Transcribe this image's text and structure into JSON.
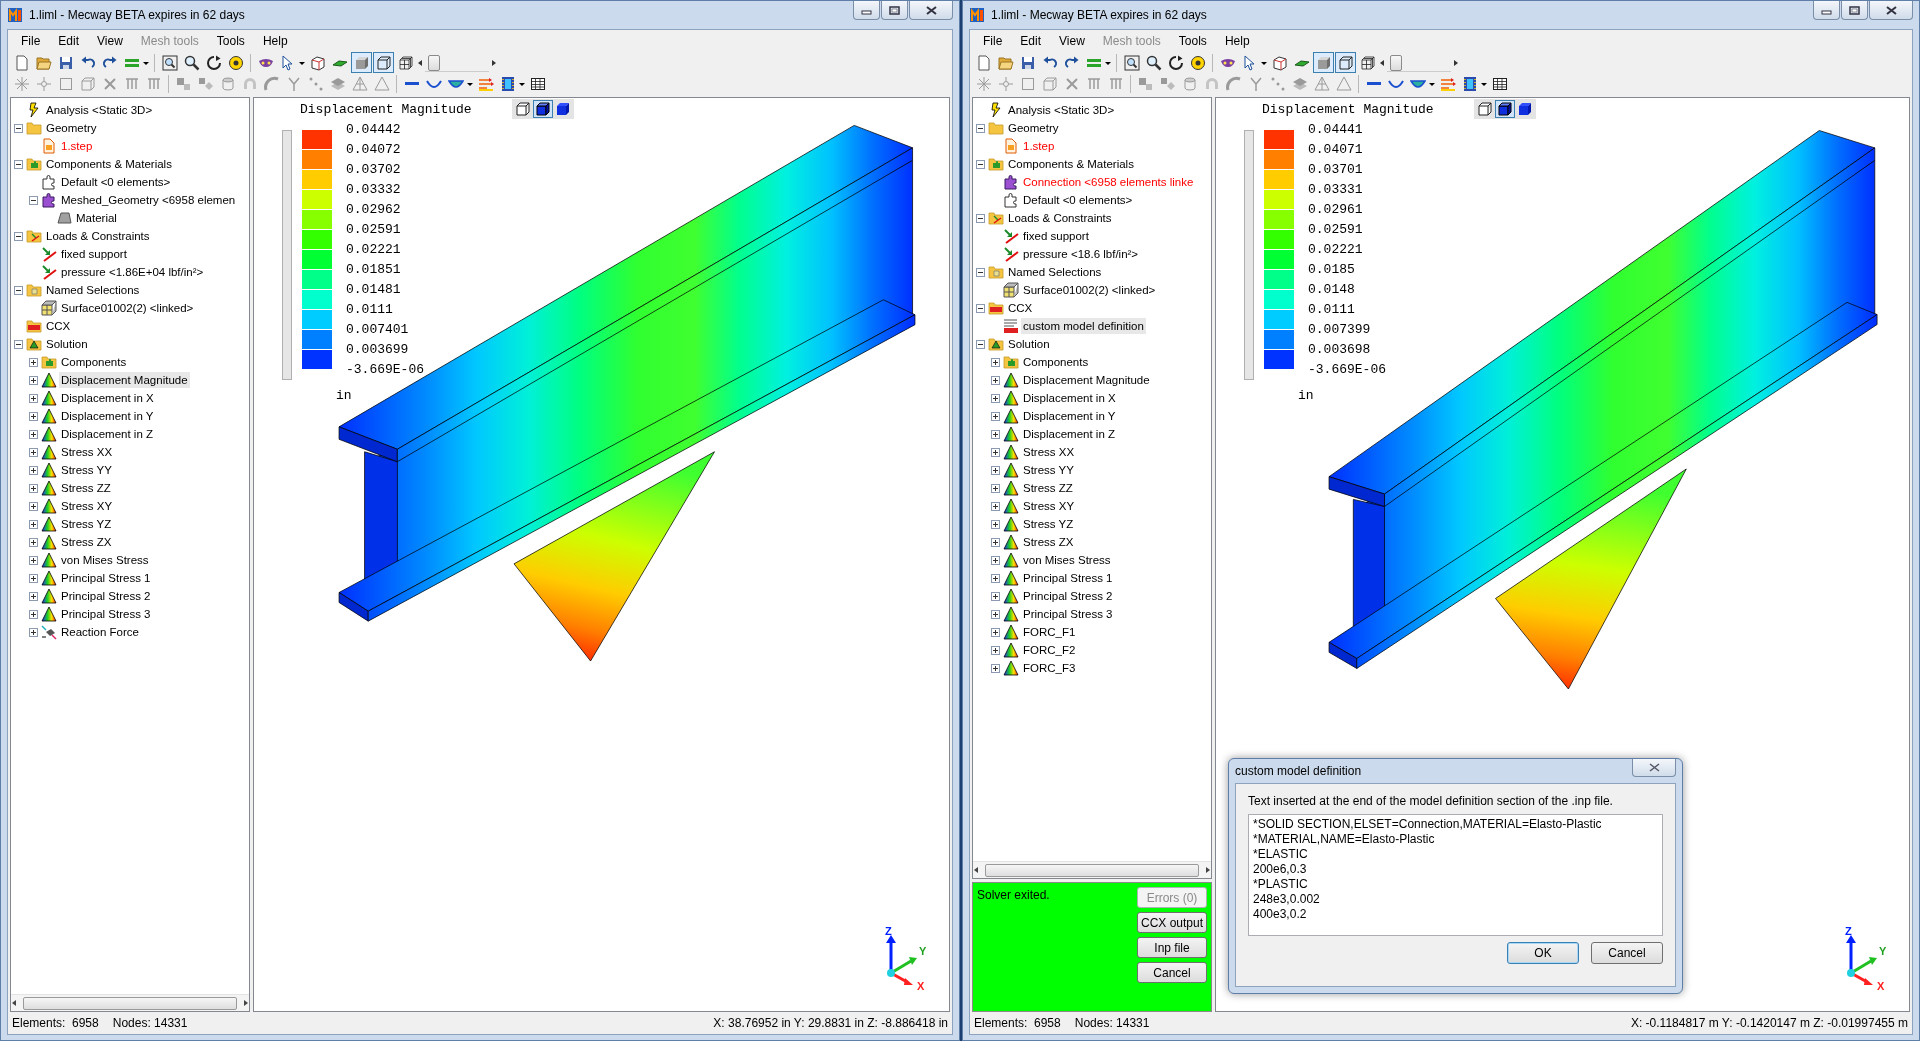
{
  "windows": [
    {
      "title": "1.liml - Mecway BETA expires in 62 days",
      "menu": [
        {
          "label": "File",
          "disabled": false
        },
        {
          "label": "Edit",
          "disabled": false
        },
        {
          "label": "View",
          "disabled": false
        },
        {
          "label": "Mesh tools",
          "disabled": true
        },
        {
          "label": "Tools",
          "disabled": false
        },
        {
          "label": "Help",
          "disabled": false
        }
      ],
      "toolbar": {
        "display_toggles": [
          {
            "selected": true
          },
          {
            "selected": true
          }
        ],
        "slider": {
          "level": 0.05
        }
      },
      "tree": [
        {
          "label": "Analysis <Static 3D>",
          "kind": "analysis",
          "selected": false,
          "flagged": false
        },
        {
          "label": "Geometry",
          "kind": "folder",
          "expanded": true,
          "selected": false,
          "flagged": false,
          "children": [
            {
              "label": "1.step",
              "kind": "file",
              "selected": false,
              "flagged": true
            }
          ]
        },
        {
          "label": "Components & Materials",
          "kind": "components",
          "expanded": true,
          "selected": false,
          "flagged": false,
          "children": [
            {
              "label": "Default <0 elements>",
              "kind": "part-empty",
              "selected": false,
              "flagged": false
            },
            {
              "label": "Meshed_Geometry <6958 elemen",
              "kind": "part",
              "expanded": true,
              "selected": false,
              "flagged": false,
              "children": [
                {
                  "label": "Material",
                  "kind": "material",
                  "selected": false,
                  "flagged": false
                }
              ]
            }
          ]
        },
        {
          "label": "Loads & Constraints",
          "kind": "loads",
          "expanded": true,
          "selected": false,
          "flagged": false,
          "children": [
            {
              "label": "fixed support",
              "kind": "load",
              "selected": false,
              "flagged": false
            },
            {
              "label": "pressure <1.86E+04 lbf/in²>",
              "kind": "load",
              "selected": false,
              "flagged": false
            }
          ]
        },
        {
          "label": "Named Selections",
          "kind": "selections",
          "expanded": true,
          "selected": false,
          "flagged": false,
          "children": [
            {
              "label": "Surface01002(2) <linked>",
              "kind": "selection",
              "selected": false,
              "flagged": false
            }
          ]
        },
        {
          "label": "CCX",
          "kind": "ccx",
          "selected": false,
          "flagged": false
        },
        {
          "label": "Solution",
          "kind": "solution",
          "expanded": true,
          "selected": false,
          "flagged": false,
          "children": [
            {
              "label": "Components",
              "kind": "components",
              "expanded": false,
              "selected": false,
              "flagged": false
            },
            {
              "label": "Displacement Magnitude",
              "kind": "result",
              "expanded": false,
              "selected": true,
              "flagged": false
            },
            {
              "label": "Displacement in X",
              "kind": "result",
              "expanded": false,
              "selected": false,
              "flagged": false
            },
            {
              "label": "Displacement in Y",
              "kind": "result",
              "expanded": false,
              "selected": false,
              "flagged": false
            },
            {
              "label": "Displacement in Z",
              "kind": "result",
              "expanded": false,
              "selected": false,
              "flagged": false
            },
            {
              "label": "Stress XX",
              "kind": "result",
              "expanded": false,
              "selected": false,
              "flagged": false
            },
            {
              "label": "Stress YY",
              "kind": "result",
              "expanded": false,
              "selected": false,
              "flagged": false
            },
            {
              "label": "Stress ZZ",
              "kind": "result",
              "expanded": false,
              "selected": false,
              "flagged": false
            },
            {
              "label": "Stress XY",
              "kind": "result",
              "expanded": false,
              "selected": false,
              "flagged": false
            },
            {
              "label": "Stress YZ",
              "kind": "result",
              "expanded": false,
              "selected": false,
              "flagged": false
            },
            {
              "label": "Stress ZX",
              "kind": "result",
              "expanded": false,
              "selected": false,
              "flagged": false
            },
            {
              "label": "von Mises Stress",
              "kind": "result",
              "expanded": false,
              "selected": false,
              "flagged": false
            },
            {
              "label": "Principal Stress 1",
              "kind": "result",
              "expanded": false,
              "selected": false,
              "flagged": false
            },
            {
              "label": "Principal Stress 2",
              "kind": "result",
              "expanded": false,
              "selected": false,
              "flagged": false
            },
            {
              "label": "Principal Stress 3",
              "kind": "result",
              "expanded": false,
              "selected": false,
              "flagged": false
            },
            {
              "label": "Reaction Force",
              "kind": "reaction",
              "expanded": false,
              "selected": false,
              "flagged": false
            }
          ]
        }
      ],
      "viewport": {
        "view_buttons": [
          {
            "selected": false
          },
          {
            "selected": true
          },
          {
            "selected": false
          }
        ],
        "legend": {
          "title": "Displacement Magnitude",
          "labels": [
            "0.04442",
            "0.04072",
            "0.03702",
            "0.03332",
            "0.02962",
            "0.02591",
            "0.02221",
            "0.01851",
            "0.01481",
            "0.0111",
            "0.007401",
            "0.003699",
            "-3.669E-06"
          ],
          "bands": [
            {
              "color": "#ff3300"
            },
            {
              "color": "#ff8000"
            },
            {
              "color": "#ffcc00"
            },
            {
              "color": "#ccff00"
            },
            {
              "color": "#88ff00"
            },
            {
              "color": "#33ff00"
            },
            {
              "color": "#00ff33"
            },
            {
              "color": "#00ff88"
            },
            {
              "color": "#00ffcc"
            },
            {
              "color": "#00ccff"
            },
            {
              "color": "#0080ff"
            },
            {
              "color": "#0033ff"
            }
          ],
          "unit": "in"
        },
        "axes": {
          "z": "Z",
          "y": "Y",
          "x": "X"
        }
      },
      "status_bar": {
        "elements": "Elements:  6958",
        "nodes": "Nodes: 14331",
        "coordinates": "X: 38.76952 in Y: 29.8831 in Z: -8.886418 in"
      }
    },
    {
      "title": "1.liml - Mecway BETA expires in 62 days",
      "menu": [
        {
          "label": "File",
          "disabled": false
        },
        {
          "label": "Edit",
          "disabled": false
        },
        {
          "label": "View",
          "disabled": false
        },
        {
          "label": "Mesh tools",
          "disabled": true
        },
        {
          "label": "Tools",
          "disabled": false
        },
        {
          "label": "Help",
          "disabled": false
        }
      ],
      "toolbar": {
        "display_toggles": [
          {
            "selected": true
          },
          {
            "selected": true
          }
        ],
        "slider": {
          "level": 0.05
        }
      },
      "tree": [
        {
          "label": "Analysis <Static 3D>",
          "kind": "analysis",
          "selected": false,
          "flagged": false
        },
        {
          "label": "Geometry",
          "kind": "folder",
          "expanded": true,
          "selected": false,
          "flagged": false,
          "children": [
            {
              "label": "1.step",
              "kind": "file",
              "selected": false,
              "flagged": true
            }
          ]
        },
        {
          "label": "Components & Materials",
          "kind": "components",
          "expanded": true,
          "selected": false,
          "flagged": false,
          "children": [
            {
              "label": "Connection <6958 elements linke",
              "kind": "part",
              "selected": false,
              "flagged": true
            },
            {
              "label": "Default <0 elements>",
              "kind": "part-empty",
              "selected": false,
              "flagged": false
            }
          ]
        },
        {
          "label": "Loads & Constraints",
          "kind": "loads",
          "expanded": true,
          "selected": false,
          "flagged": false,
          "children": [
            {
              "label": "fixed support",
              "kind": "load",
              "selected": false,
              "flagged": false
            },
            {
              "label": "pressure <18.6 lbf/in²>",
              "kind": "load",
              "selected": false,
              "flagged": false
            }
          ]
        },
        {
          "label": "Named Selections",
          "kind": "selections",
          "expanded": true,
          "selected": false,
          "flagged": false,
          "children": [
            {
              "label": "Surface01002(2) <linked>",
              "kind": "selection",
              "selected": false,
              "flagged": false
            }
          ]
        },
        {
          "label": "CCX",
          "kind": "ccx",
          "expanded": true,
          "selected": false,
          "flagged": false,
          "children": [
            {
              "label": "custom model definition",
              "kind": "ccx-text",
              "selected": true,
              "flagged": false
            }
          ]
        },
        {
          "label": "Solution",
          "kind": "solution",
          "expanded": true,
          "selected": false,
          "flagged": false,
          "children": [
            {
              "label": "Components",
              "kind": "components",
              "expanded": false,
              "selected": false,
              "flagged": false
            },
            {
              "label": "Displacement Magnitude",
              "kind": "result",
              "expanded": false,
              "selected": false,
              "flagged": false
            },
            {
              "label": "Displacement in X",
              "kind": "result",
              "expanded": false,
              "selected": false,
              "flagged": false
            },
            {
              "label": "Displacement in Y",
              "kind": "result",
              "expanded": false,
              "selected": false,
              "flagged": false
            },
            {
              "label": "Displacement in Z",
              "kind": "result",
              "expanded": false,
              "selected": false,
              "flagged": false
            },
            {
              "label": "Stress XX",
              "kind": "result",
              "expanded": false,
              "selected": false,
              "flagged": false
            },
            {
              "label": "Stress YY",
              "kind": "result",
              "expanded": false,
              "selected": false,
              "flagged": false
            },
            {
              "label": "Stress ZZ",
              "kind": "result",
              "expanded": false,
              "selected": false,
              "flagged": false
            },
            {
              "label": "Stress XY",
              "kind": "result",
              "expanded": false,
              "selected": false,
              "flagged": false
            },
            {
              "label": "Stress YZ",
              "kind": "result",
              "expanded": false,
              "selected": false,
              "flagged": false
            },
            {
              "label": "Stress ZX",
              "kind": "result",
              "expanded": false,
              "selected": false,
              "flagged": false
            },
            {
              "label": "von Mises Stress",
              "kind": "result",
              "expanded": false,
              "selected": false,
              "flagged": false
            },
            {
              "label": "Principal Stress 1",
              "kind": "result",
              "expanded": false,
              "selected": false,
              "flagged": false
            },
            {
              "label": "Principal Stress 2",
              "kind": "result",
              "expanded": false,
              "selected": false,
              "flagged": false
            },
            {
              "label": "Principal Stress 3",
              "kind": "result",
              "expanded": false,
              "selected": false,
              "flagged": false
            },
            {
              "label": "FORC_F1",
              "kind": "result",
              "expanded": false,
              "selected": false,
              "flagged": false
            },
            {
              "label": "FORC_F2",
              "kind": "result",
              "expanded": false,
              "selected": false,
              "flagged": false
            },
            {
              "label": "FORC_F3",
              "kind": "result",
              "expanded": false,
              "selected": false,
              "flagged": false
            }
          ]
        }
      ],
      "solver": {
        "message": "Solver exited.",
        "buttons": [
          {
            "label": "Errors (0)",
            "disabled": true
          },
          {
            "label": "CCX output",
            "disabled": false
          },
          {
            "label": "Inp file",
            "disabled": false
          },
          {
            "label": "Cancel",
            "disabled": false
          }
        ]
      },
      "viewport": {
        "view_buttons": [
          {
            "selected": false
          },
          {
            "selected": true
          },
          {
            "selected": false
          }
        ],
        "legend": {
          "title": "Displacement Magnitude",
          "labels": [
            "0.04441",
            "0.04071",
            "0.03701",
            "0.03331",
            "0.02961",
            "0.02591",
            "0.02221",
            "0.0185",
            "0.0148",
            "0.0111",
            "0.007399",
            "0.003698",
            "-3.669E-06"
          ],
          "bands": [
            {
              "color": "#ff3300"
            },
            {
              "color": "#ff8000"
            },
            {
              "color": "#ffcc00"
            },
            {
              "color": "#ccff00"
            },
            {
              "color": "#88ff00"
            },
            {
              "color": "#33ff00"
            },
            {
              "color": "#00ff33"
            },
            {
              "color": "#00ff88"
            },
            {
              "color": "#00ffcc"
            },
            {
              "color": "#00ccff"
            },
            {
              "color": "#0080ff"
            },
            {
              "color": "#0033ff"
            }
          ],
          "unit": "in"
        },
        "axes": {
          "z": "Z",
          "y": "Y",
          "x": "X"
        }
      },
      "dialog": {
        "title": "custom model definition",
        "prompt": "Text inserted at the end of the model definition section of the .inp file.",
        "value": "*SOLID SECTION,ELSET=Connection,MATERIAL=Elasto-Plastic\n*MATERIAL,NAME=Elasto-Plastic\n*ELASTIC\n200e6,0.3\n*PLASTIC\n248e3,0.002\n400e3,0.2",
        "buttons": [
          {
            "label": "OK",
            "default": true
          },
          {
            "label": "Cancel",
            "default": false
          }
        ]
      },
      "status_bar": {
        "elements": "Elements:  6958",
        "nodes": "Nodes: 14331",
        "coordinates": "X: -0.1184817 m Y: -0.1420147 m Z: -0.01997455 m"
      }
    }
  ]
}
